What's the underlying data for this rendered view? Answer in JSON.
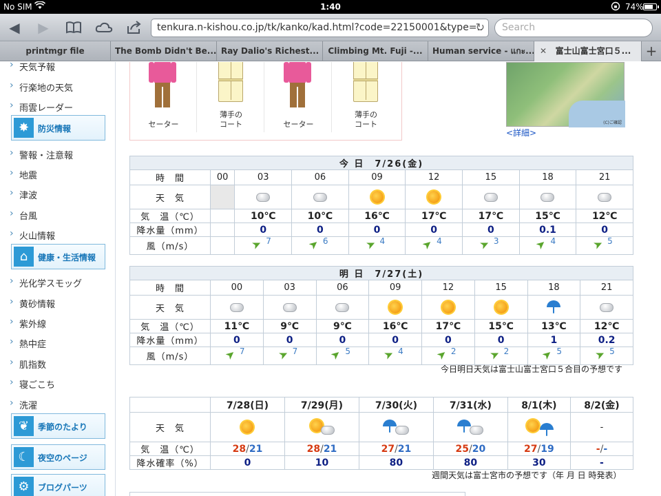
{
  "status": {
    "carrier": "No SIM",
    "time": "1:40",
    "battery": "74%",
    "battery_level": 0.74
  },
  "browser": {
    "url": "tenkura.n-kishou.co.jp/tk/kanko/kad.html?code=22150001&type=..",
    "search_placeholder": "Search",
    "tabs": [
      {
        "label": "printmgr file"
      },
      {
        "label": "The Bomb Didn't Be..."
      },
      {
        "label": "Ray Dalio's Richest..."
      },
      {
        "label": "Climbing Mt. Fuji -..."
      },
      {
        "label": "Human service - แกะ..."
      },
      {
        "label": "富士山富士宮口５..."
      }
    ]
  },
  "sidebar": {
    "items_top": [
      "天気予報",
      "行楽地の天気",
      "雨雲レーダー"
    ],
    "bousai_header": "防災情報",
    "bousai_items": [
      "警報・注意報",
      "地震",
      "津波",
      "台風",
      "火山情報"
    ],
    "kenkou_header": "健康・生活情報",
    "kenkou_items": [
      "光化学スモッグ",
      "黄砂情報",
      "紫外線",
      "熱中症",
      "肌指数",
      "寝ごこち",
      "洗濯"
    ],
    "kisetsu": "季節のたより",
    "yozora": "夜空のページ",
    "parts": "ブログパーツ"
  },
  "clothes": [
    {
      "label": "セーター",
      "type": "sweater"
    },
    {
      "label": "薄手の\nコート",
      "type": "coat"
    },
    {
      "label": "セーター",
      "type": "sweater"
    },
    {
      "label": "薄手の\nコート",
      "type": "coat"
    }
  ],
  "map": {
    "detail_link": "<詳細>",
    "credit": "(C)ご確認"
  },
  "today": {
    "title": "今 日　7/26(金)",
    "labels": {
      "time": "時　間",
      "weather": "天　気",
      "temp": "気　温（℃）",
      "precip": "降水量（mm）",
      "wind": "風（m/s）"
    },
    "hours": [
      "00",
      "03",
      "06",
      "09",
      "12",
      "15",
      "18",
      "21"
    ],
    "weather": [
      "",
      "cloud",
      "cloud",
      "sun",
      "sun",
      "cloud",
      "cloud",
      "cloud"
    ],
    "temps": [
      "",
      "10℃",
      "10℃",
      "16℃",
      "17℃",
      "17℃",
      "15℃",
      "12℃"
    ],
    "precip": [
      "",
      "0",
      "0",
      "0",
      "0",
      "0",
      "0.1",
      "0"
    ],
    "wind": [
      "",
      "7",
      "6",
      "4",
      "4",
      "3",
      "4",
      "5"
    ]
  },
  "tomorrow": {
    "title": "明 日　7/27(土)",
    "hours": [
      "00",
      "03",
      "06",
      "09",
      "12",
      "15",
      "18",
      "21"
    ],
    "weather": [
      "cloud",
      "cloud",
      "cloud",
      "sun",
      "sun",
      "sun",
      "umbrella",
      "cloud"
    ],
    "temps": [
      "11℃",
      "9℃",
      "9℃",
      "16℃",
      "17℃",
      "15℃",
      "13℃",
      "12℃"
    ],
    "precip": [
      "0",
      "0",
      "0",
      "0",
      "0",
      "0",
      "1",
      "0.2"
    ],
    "wind": [
      "7",
      "7",
      "5",
      "4",
      "2",
      "2",
      "5",
      "5"
    ]
  },
  "forecast_note": "今日明日天気は富士山富士宮口５合目の予想です",
  "weekly": {
    "labels": {
      "weather": "天　気",
      "temp": "気　温（℃）",
      "pop": "降水確率（%）"
    },
    "days": [
      {
        "date": "7/28(日)",
        "icon": "sun",
        "hi": "28",
        "lo": "21",
        "pop": "0"
      },
      {
        "date": "7/29(月)",
        "icon": "sun-cloud",
        "hi": "28",
        "lo": "21",
        "pop": "10"
      },
      {
        "date": "7/30(火)",
        "icon": "rain-cloud",
        "hi": "27",
        "lo": "21",
        "pop": "80"
      },
      {
        "date": "7/31(水)",
        "icon": "rain-cloud",
        "hi": "25",
        "lo": "20",
        "pop": "80"
      },
      {
        "date": "8/1(木)",
        "icon": "sun-rain",
        "hi": "27",
        "lo": "19",
        "pop": "30"
      },
      {
        "date": "8/2(金)",
        "icon": "none",
        "hi": "-",
        "lo": "-",
        "pop": "-",
        "weather_text": "-"
      }
    ],
    "note": "週間天気は富士宮市の予想です（年 月 日 時発表）"
  }
}
